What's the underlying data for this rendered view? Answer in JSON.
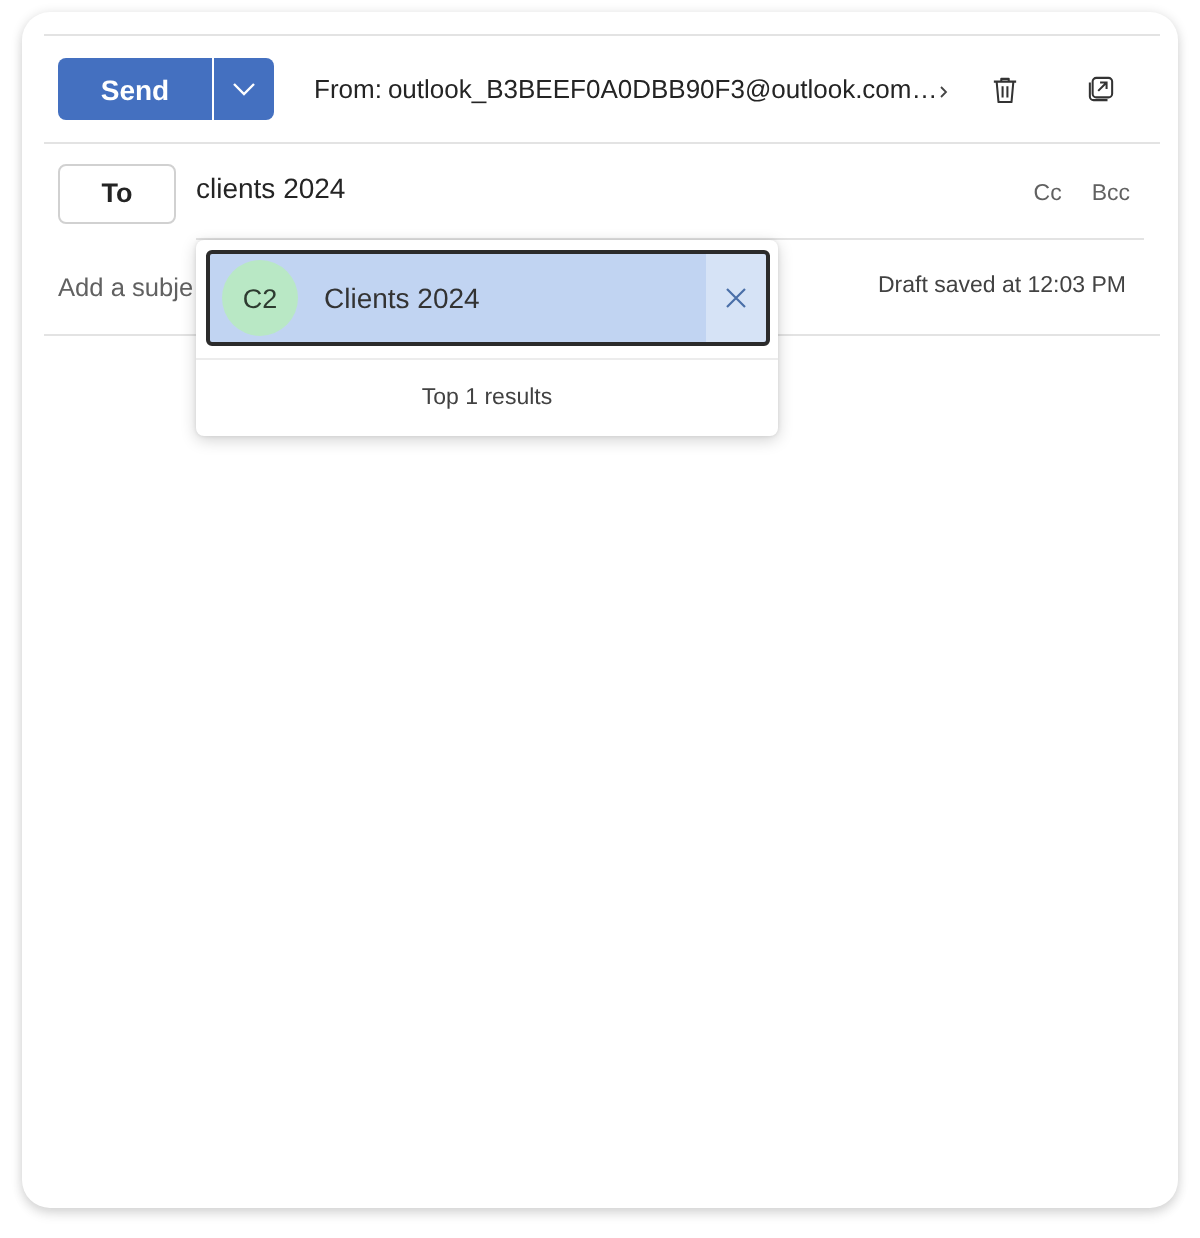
{
  "compose": {
    "send_button": "Send",
    "from_label": "From:",
    "from_address": "outlook_B3BEEF0A0DBB90F3@outlook.com…"
  },
  "recipients": {
    "to_button": "To",
    "to_value": "clients 2024",
    "cc": "Cc",
    "bcc": "Bcc"
  },
  "subject": {
    "placeholder": "Add a subje",
    "draft_status": "Draft saved at 12:03 PM"
  },
  "suggestions": {
    "items": [
      {
        "initials": "C2",
        "name": "Clients 2024",
        "selected": true
      }
    ],
    "footer": "Top 1 results"
  }
}
